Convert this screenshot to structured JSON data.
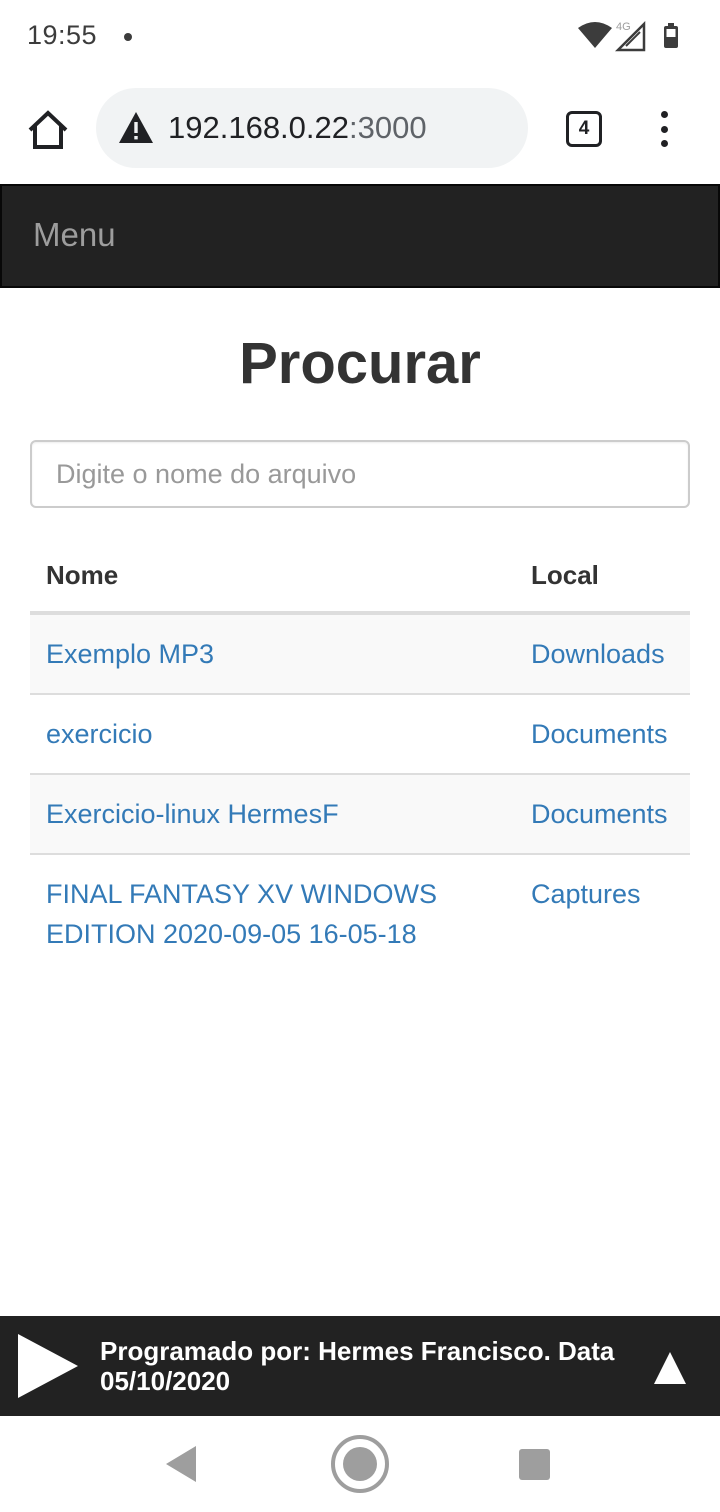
{
  "status_bar": {
    "time": "19:55",
    "network": "4G"
  },
  "browser": {
    "url_host": "192.168.0.22",
    "url_port": ":3000",
    "tab_count": "4",
    "icons": [
      "home-icon",
      "warning-icon",
      "tabs-icon",
      "more-vert-icon"
    ]
  },
  "navbar": {
    "brand": "Menu"
  },
  "main": {
    "title": "Procurar",
    "search_placeholder": "Digite o nome do arquivo",
    "search_value": "",
    "table": {
      "headers": [
        "Nome",
        "Local"
      ],
      "rows": [
        {
          "name": "Exemplo MP3",
          "local": "Downloads"
        },
        {
          "name": "exercicio",
          "local": "Documents"
        },
        {
          "name": "Exercicio-linux HermesF",
          "local": "Documents"
        },
        {
          "name": "FINAL FANTASY XV WINDOWS EDITION 2020-09-05 16-05-18",
          "local": "Captures"
        }
      ]
    }
  },
  "footer": {
    "text": "Programado por: Hermes Francisco. Data 05/10/2020",
    "icons": [
      "play-icon",
      "arrow-up-icon"
    ]
  },
  "colors": {
    "navbar_bg": "#222222",
    "navbar_text": "#9d9d9d",
    "link": "#337ab7",
    "footer_bg": "#222222"
  }
}
